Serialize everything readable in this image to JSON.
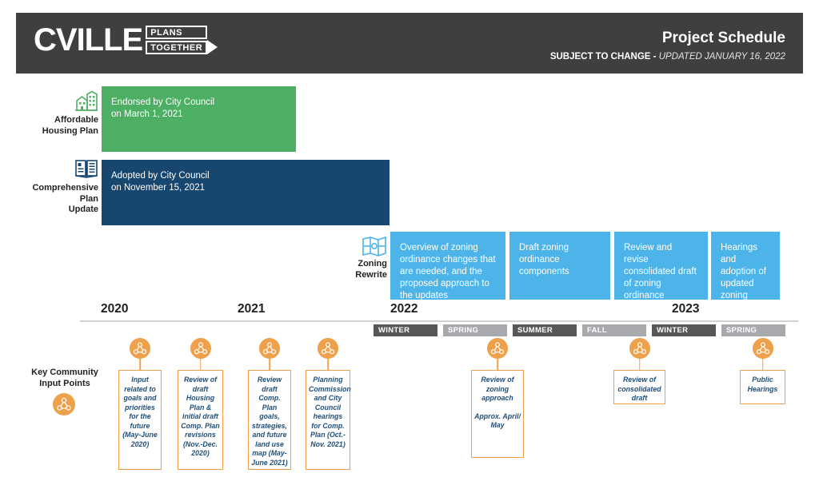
{
  "header": {
    "logo": {
      "word": "CVILLE",
      "box_top": "PLANS",
      "box_bottom": "TOGETHER",
      "arrow_icon": "arrow-right-icon"
    },
    "title": "Project Schedule",
    "subject_to_change": "SUBJECT TO CHANGE - ",
    "updated": "UPDATED JANUARY 16, 2022",
    "background_color": "#3f3f42"
  },
  "rows": [
    {
      "icon": "house-cluster-icon",
      "label": "Affordable\nHousing Plan",
      "label_line1": "Affordable",
      "label_line2": "Housing Plan",
      "color": "#4caf63",
      "bars": [
        {
          "text": "Endorsed by City Council\non March 1, 2021"
        }
      ]
    },
    {
      "icon": "open-book-icon",
      "label_line1": "Comprehensive",
      "label_line2": "Plan",
      "label_line3": "Update",
      "color": "#17466f",
      "bars": [
        {
          "text": "Adopted by City Council\non November 15, 2021"
        }
      ]
    },
    {
      "icon": "map-icon",
      "label_line1": "Zoning",
      "label_line2": "Rewrite",
      "color": "#4db4ea",
      "bars": [
        {
          "text": "Overview of zoning ordinance changes that are needed, and the proposed approach to the updates"
        },
        {
          "text": "Draft zoning ordinance components"
        },
        {
          "text": "Review and revise consolidated draft of zoning ordinance"
        },
        {
          "text": "Hearings and adoption of updated zoning ordinance"
        }
      ]
    }
  ],
  "timeline": {
    "years": [
      "2020",
      "2021",
      "2022",
      "2023"
    ],
    "seasons": [
      {
        "label": "WINTER",
        "tone": "dark"
      },
      {
        "label": "SPRING",
        "tone": "light"
      },
      {
        "label": "SUMMER",
        "tone": "dark"
      },
      {
        "label": "FALL",
        "tone": "light"
      },
      {
        "label": "WINTER",
        "tone": "dark"
      },
      {
        "label": "SPRING",
        "tone": "light"
      }
    ]
  },
  "key_community_input": {
    "label_line1": "Key Community",
    "label_line2": "Input Points",
    "legend_icon": "community-input-icon",
    "accent_color": "#efa04b",
    "text_color": "#1f4e79",
    "points": [
      {
        "icon": "community-input-icon",
        "lines": [
          "Input related to goals and priorities for the future (May-June 2020)"
        ]
      },
      {
        "icon": "community-input-icon",
        "lines": [
          "Review of draft Housing Plan & initial draft Comp. Plan revisions (Nov.-Dec. 2020)"
        ]
      },
      {
        "icon": "community-input-icon",
        "lines": [
          "Review draft Comp. Plan goals, strategies, and future land use map (May-June 2021)"
        ]
      },
      {
        "icon": "community-input-icon",
        "lines": [
          "Planning Commission and City Council hearings for Comp. Plan (Oct.-Nov. 2021)"
        ]
      },
      {
        "icon": "community-input-icon",
        "lines": [
          "Review of zoning approach",
          "Approx. April/ May"
        ]
      },
      {
        "icon": "community-input-icon",
        "lines": [
          "Review of consolidated draft"
        ]
      },
      {
        "icon": "community-input-icon",
        "lines": [
          "Public Hearings"
        ]
      }
    ]
  }
}
